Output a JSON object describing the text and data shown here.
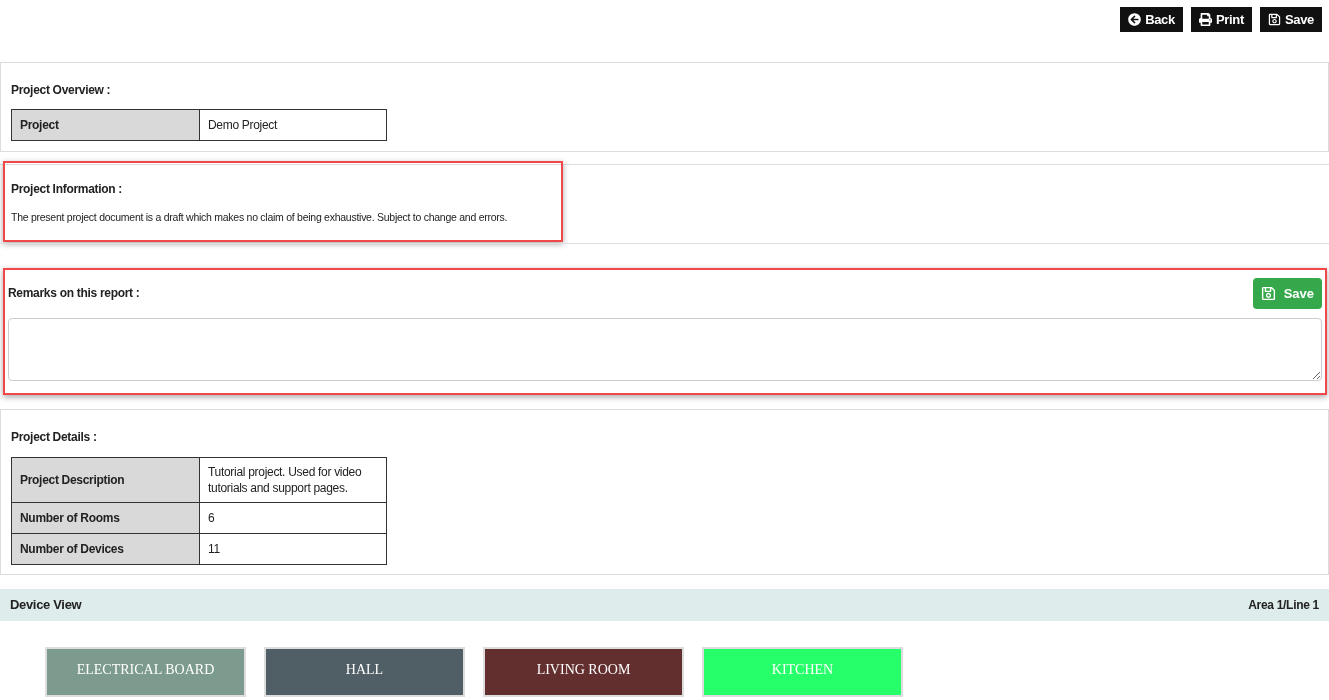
{
  "toolbar": [
    {
      "kind": "back",
      "label": "Back"
    },
    {
      "kind": "print",
      "label": "Print"
    },
    {
      "kind": "save",
      "label": "Save"
    }
  ],
  "overview": {
    "title": "Project Overview :",
    "rows": [
      {
        "label": "Project",
        "value": "Demo Project"
      }
    ]
  },
  "information": {
    "title": "Project Information :",
    "text": "The present project document is a draft which makes no claim of being exhaustive. Subject to change and errors.",
    "highlighted": true
  },
  "remarks": {
    "title": "Remarks on this report :",
    "save_label": "Save",
    "highlighted": true
  },
  "details": {
    "title": "Project Details :",
    "rows": [
      {
        "label": "Project Description",
        "value": "Tutorial project. Used for video tutorials and support pages."
      },
      {
        "label": "Number of Rooms",
        "value": "6"
      },
      {
        "label": "Number of Devices",
        "value": "11"
      }
    ]
  },
  "device_view": {
    "title": "Device View",
    "location": "Area 1/Line 1",
    "rooms": [
      {
        "name": "ELECTRICAL BOARD",
        "color": "#7c9b8e"
      },
      {
        "name": "HALL",
        "color": "#505e66"
      },
      {
        "name": "LIVING ROOM",
        "color": "#632e2e"
      },
      {
        "name": "KITCHEN",
        "color": "#26ff6a"
      }
    ]
  }
}
